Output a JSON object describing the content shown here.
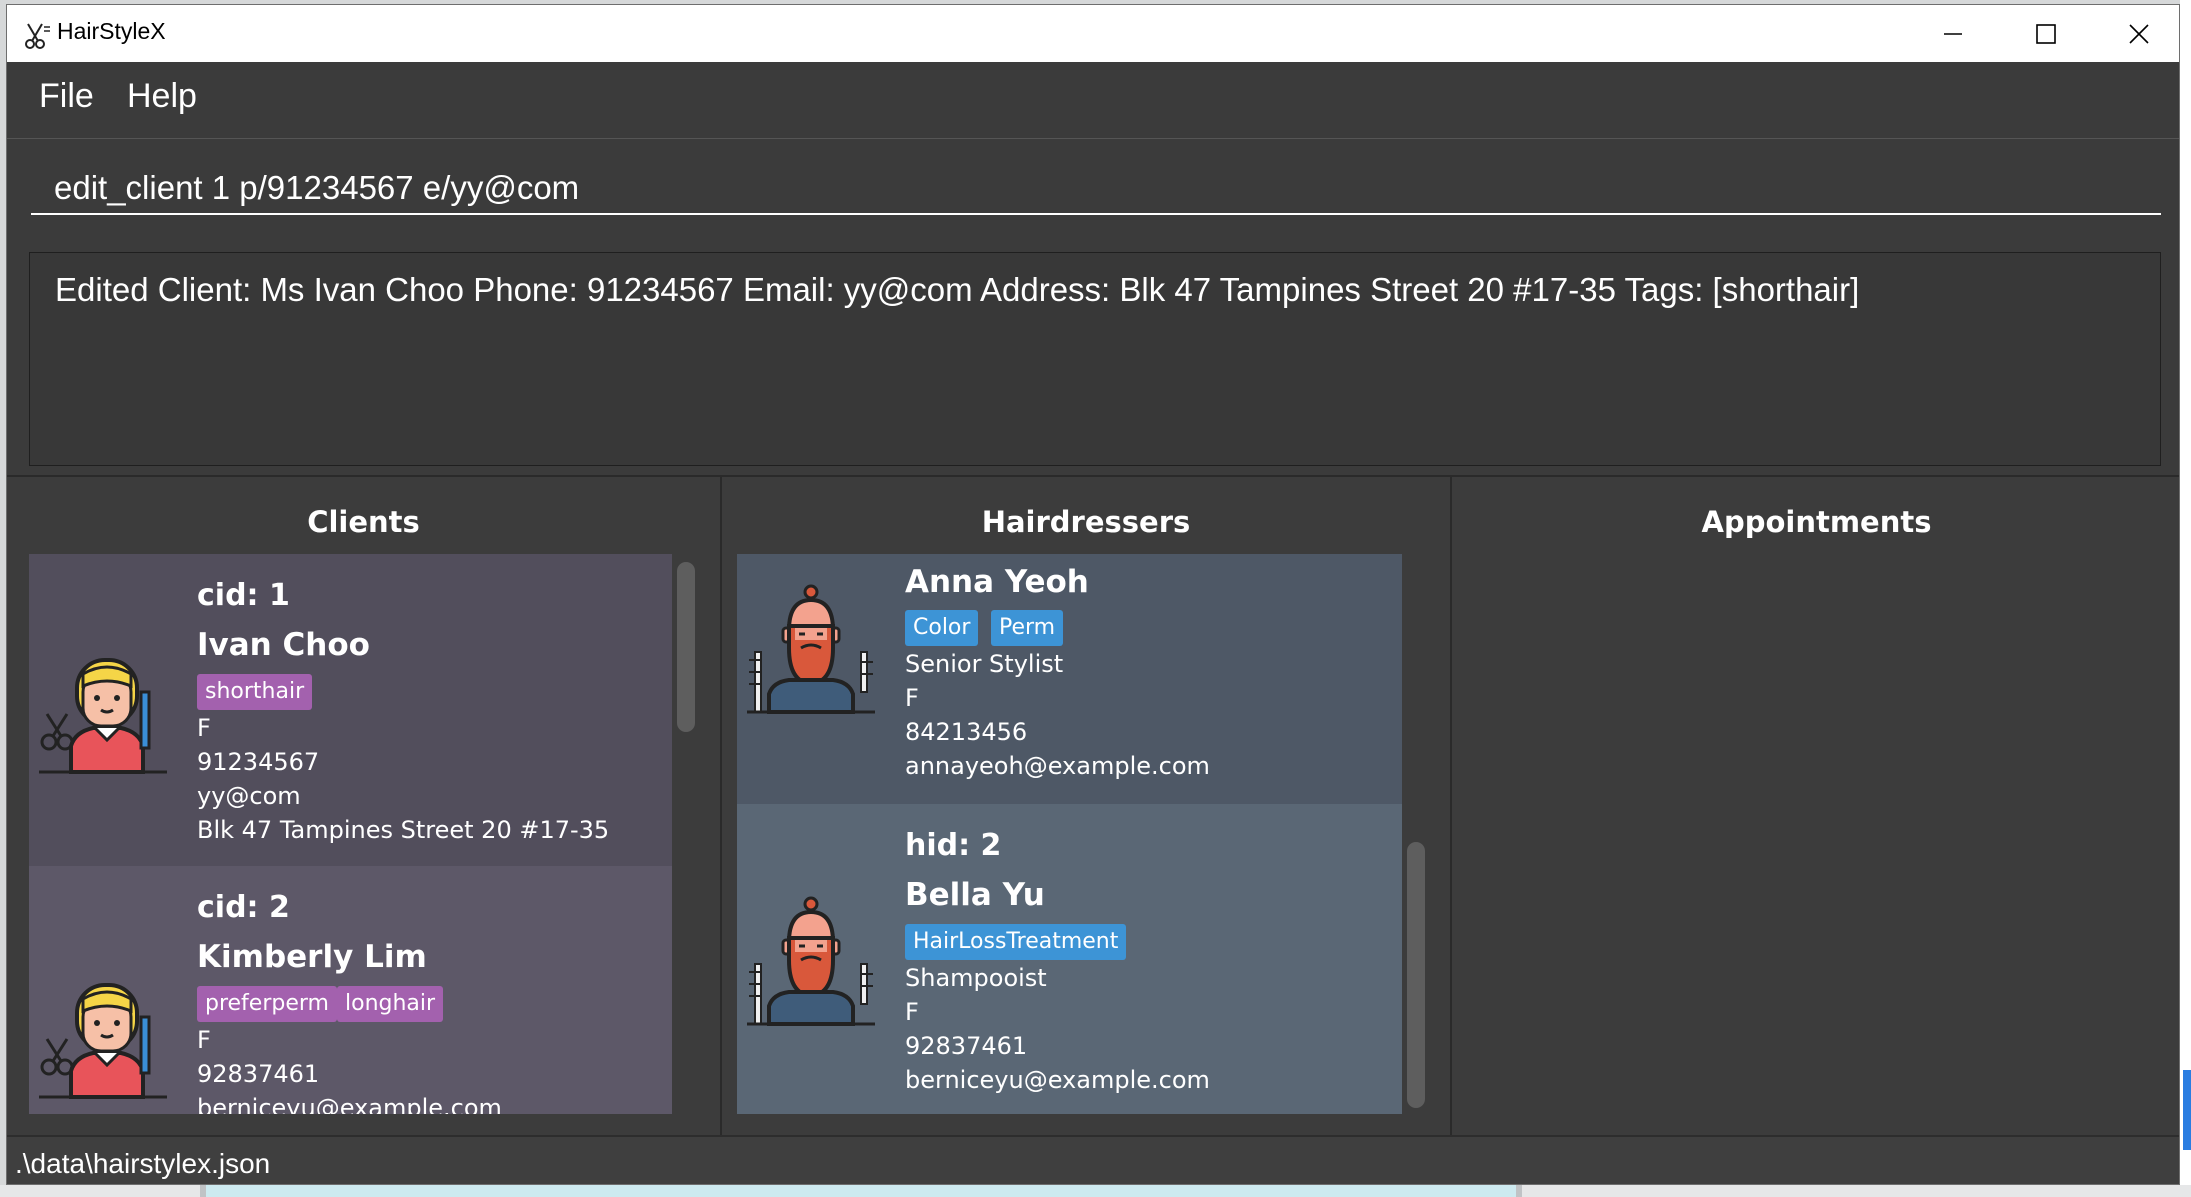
{
  "window": {
    "title": "HairStyleX",
    "menu": [
      "File",
      "Help"
    ]
  },
  "command": {
    "value": "edit_client 1 p/91234567 e/yy@com"
  },
  "result": {
    "text": "Edited Client: Ms Ivan Choo Phone: 91234567 Email: yy@com Address: Blk 47 Tampines Street 20 #17-35 Tags: [shorthair]"
  },
  "panels": {
    "clients_title": "Clients",
    "hairdressers_title": "Hairdressers",
    "appointments_title": "Appointments"
  },
  "clients": [
    {
      "id": "cid: 1",
      "name": "Ivan Choo",
      "tags": [
        "shorthair"
      ],
      "gender": "F",
      "phone": "91234567",
      "email": "yy@com",
      "address": "Blk 47 Tampines Street 20 #17-35"
    },
    {
      "id": "cid: 2",
      "name": "Kimberly Lim",
      "tags": [
        "preferperm",
        "longhair"
      ],
      "gender": "F",
      "phone": "92837461",
      "email": "berniceyu@example.com"
    }
  ],
  "hairdressers": [
    {
      "name": "Anna Yeoh",
      "tags": [
        "Color",
        "Perm"
      ],
      "title": "Senior Stylist",
      "gender": "F",
      "phone": "84213456",
      "email": "annayeoh@example.com"
    },
    {
      "id": "hid: 2",
      "name": "Bella Yu",
      "tags": [
        "HairLossTreatment"
      ],
      "title": "Shampooist",
      "gender": "F",
      "phone": "92837461",
      "email": "berniceyu@example.com"
    }
  ],
  "status": {
    "file_path": ".\\data\\hairstylex.json"
  },
  "colors": {
    "client_card": "#524e5c",
    "client_card_alt": "#5d5868",
    "hairdresser_card": "#4e5866",
    "hairdresser_card_alt": "#5a6775",
    "client_tag": "#a361ae",
    "hairdresser_tag": "#3d94d6"
  },
  "icons": {
    "app": "scissors-comb-icon",
    "client_avatar": "woman-hairdresser-icon",
    "hairdresser_avatar": "bearded-man-barber-icon"
  }
}
